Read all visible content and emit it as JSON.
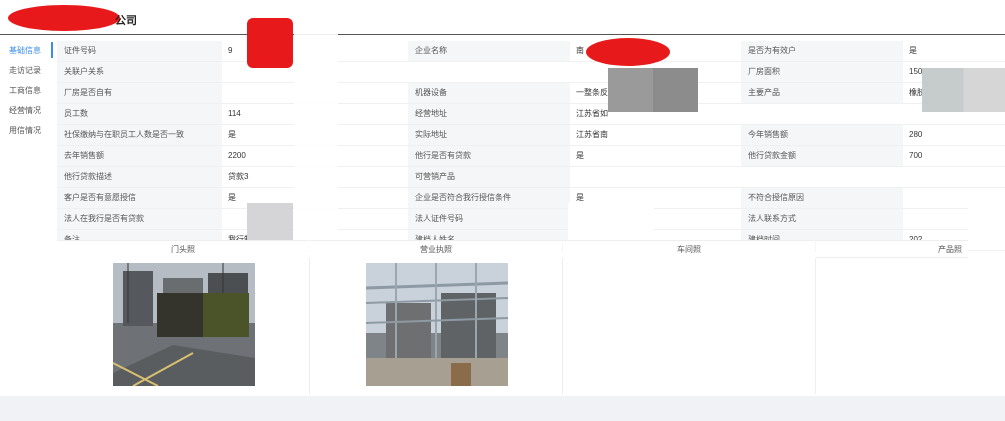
{
  "header": {
    "title_suffix": "公司"
  },
  "sidebar": {
    "items": [
      {
        "label": "基础信息",
        "active": true
      },
      {
        "label": "走访记录",
        "active": false
      },
      {
        "label": "工商信息",
        "active": false
      },
      {
        "label": "经营情况",
        "active": false
      },
      {
        "label": "用信情况",
        "active": false
      }
    ]
  },
  "info_rows": [
    {
      "l1": "证件号码",
      "v1": "9",
      "l2": "企业名称",
      "v2": "南",
      "l3": "是否为有效户",
      "v3": "是"
    },
    {
      "l1": "关联户关系",
      "v1": "",
      "l2": "",
      "v2": "",
      "l3": "厂房面积",
      "v3": "150"
    },
    {
      "l1": "厂房是否自有",
      "v1": "",
      "l2": "机器设备",
      "v2": "一整条反",
      "l3": "主要产品",
      "v3": "橡胶"
    },
    {
      "l1": "员工数",
      "v1": "114",
      "l2": "经营地址",
      "v2": "江苏省如",
      "l3": "",
      "v3": ""
    },
    {
      "l1": "社保缴纳与在职员工人数是否一致",
      "v1": "是",
      "l2": "实际地址",
      "v2": "江苏省南",
      "l3": "今年销售额",
      "v3": "280"
    },
    {
      "l1": "去年销售额",
      "v1": "2200",
      "l2": "他行是否有贷款",
      "v2": "是",
      "l3": "他行贷款金额",
      "v3": "700"
    },
    {
      "l1": "他行贷款描述",
      "v1": "贷款3",
      "l2": "可营销产品",
      "v2": "",
      "l3": "",
      "v3": ""
    },
    {
      "l1": "客户是否有意愿授信",
      "v1": "是",
      "l2": "企业是否符合我行授信条件",
      "v2": "是",
      "l3": "不符合授信原因",
      "v3": ""
    },
    {
      "l1": "法人在我行是否有贷款",
      "v1": "",
      "l2": "法人证件号码",
      "v2": "",
      "l3": "法人联系方式",
      "v3": ""
    },
    {
      "l1": "备注",
      "v1": "我行制",
      "l2": "建档人姓名",
      "v2": "",
      "l3": "建档时间",
      "v3": "202"
    }
  ],
  "photos": {
    "headers": [
      "门头照",
      "营业执照",
      "车间照",
      "产品照"
    ]
  },
  "colors": {
    "accent": "#3a8ee6",
    "redaction": "#e8191a"
  }
}
